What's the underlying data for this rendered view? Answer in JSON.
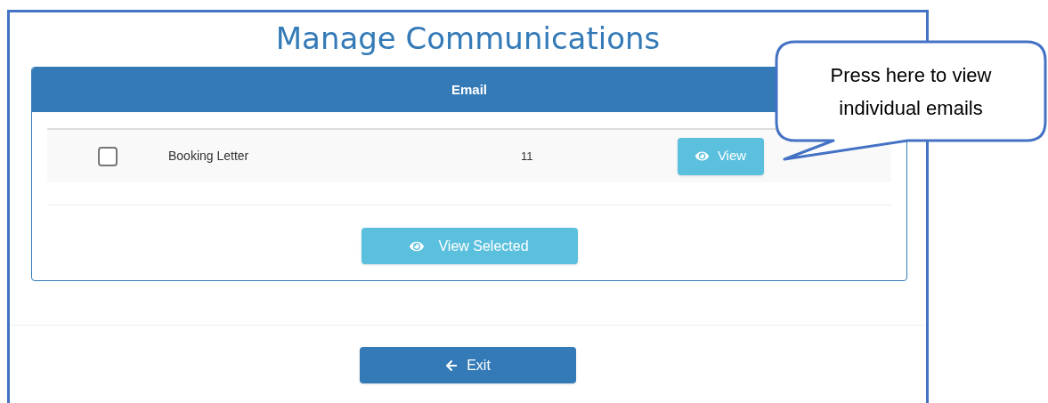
{
  "title": "Manage Communications",
  "panel": {
    "heading": "Email",
    "rows": [
      {
        "checked": false,
        "name": "Booking Letter",
        "count": "11",
        "button": "View"
      }
    ],
    "action_button": "View Selected"
  },
  "exit_button": "Exit",
  "callout": {
    "text": "Press here to view individual emails"
  }
}
